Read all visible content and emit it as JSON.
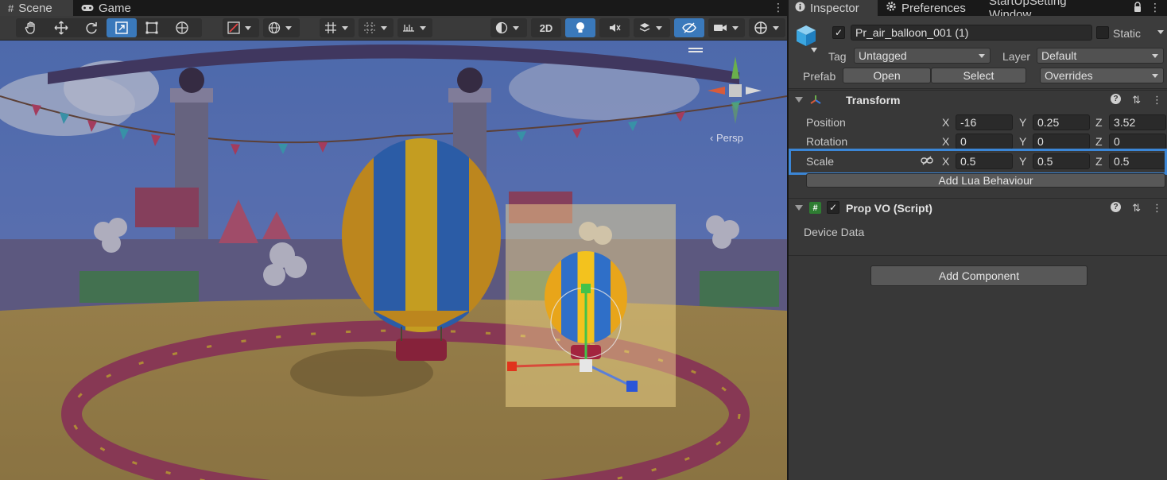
{
  "scene_tabs": [
    {
      "label": "Scene",
      "icon": "hash-icon"
    },
    {
      "label": "Game",
      "icon": "gamepad-icon"
    }
  ],
  "toolbar": {
    "transform_tools": [
      "hand-tool",
      "move-tool",
      "rotate-tool",
      "scale-tool",
      "rect-tool",
      "transform-tool"
    ],
    "active_tool_index": 3,
    "mode_2d_label": "2D"
  },
  "inspector_tabs": [
    {
      "label": "Inspector",
      "icon": "info-icon"
    },
    {
      "label": "Preferences",
      "icon": "gear-icon"
    },
    {
      "label": "StartUpSetting Window",
      "icon": ""
    }
  ],
  "object": {
    "enabled": true,
    "name": "Pr_air_balloon_001 (1)",
    "static_label": "Static",
    "tag_label": "Tag",
    "tag_value": "Untagged",
    "layer_label": "Layer",
    "layer_value": "Default",
    "prefab_label": "Prefab",
    "prefab_open": "Open",
    "prefab_select": "Select",
    "prefab_overrides": "Overrides"
  },
  "transform": {
    "title": "Transform",
    "rows": [
      {
        "label": "Position",
        "x": "-16",
        "y": "0.25",
        "z": "3.52"
      },
      {
        "label": "Rotation",
        "x": "0",
        "y": "0",
        "z": "0"
      },
      {
        "label": "Scale",
        "x": "0.5",
        "y": "0.5",
        "z": "0.5"
      }
    ],
    "add_lua_label": "Add Lua Behaviour"
  },
  "prop_vo": {
    "title": "Prop VO (Script)",
    "enabled": true,
    "field_label": "Device Data"
  },
  "add_component_label": "Add Component",
  "viewport": {
    "persp_label": "‹ Persp"
  },
  "colors": {
    "accent": "#3a79bb",
    "highlight": "#3b86d6",
    "panel": "#383838"
  }
}
